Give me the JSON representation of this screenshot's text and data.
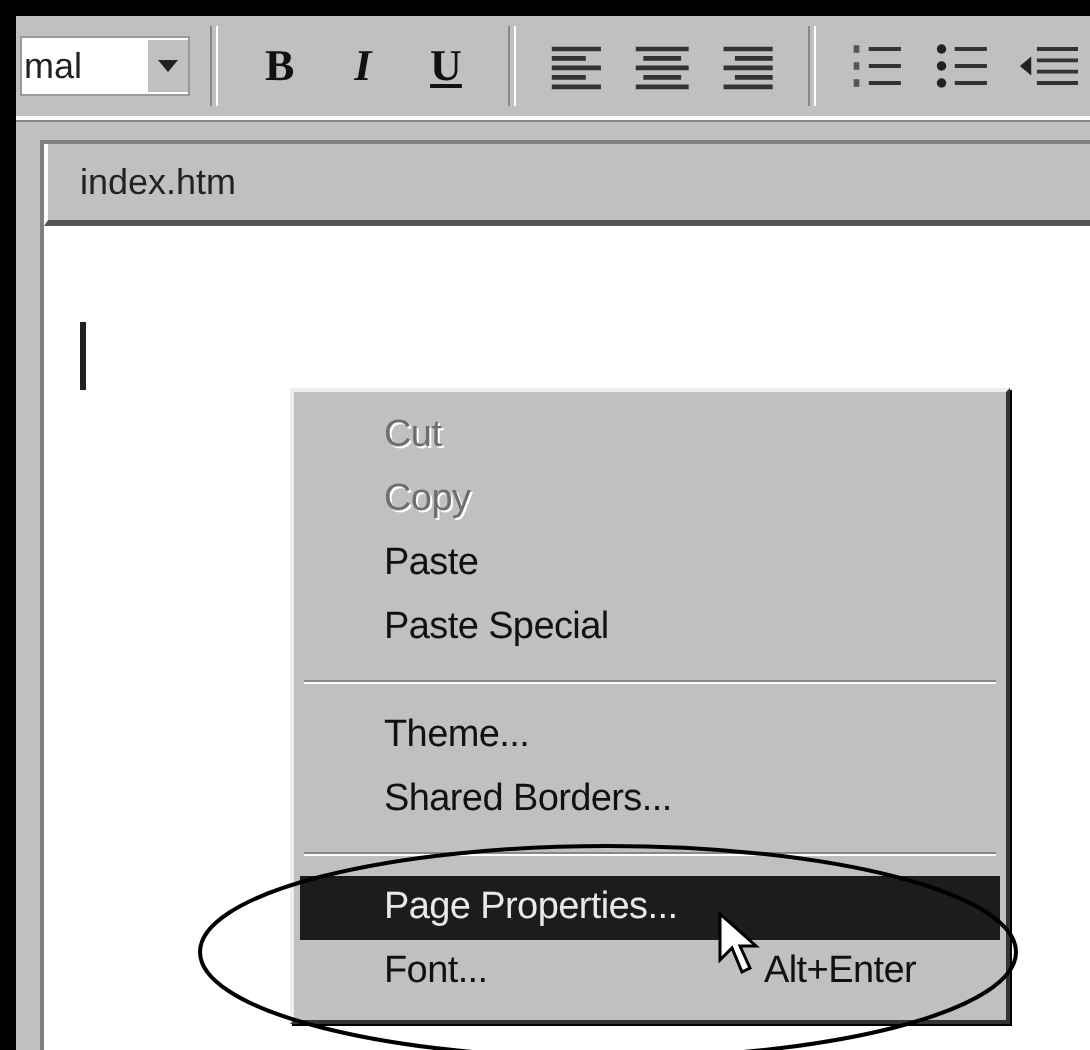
{
  "toolbar": {
    "style_field": {
      "value": "mal"
    },
    "format_buttons": [
      {
        "kind": "bold",
        "label": "B"
      },
      {
        "kind": "italic",
        "label": "I"
      },
      {
        "kind": "underline",
        "label": "U"
      }
    ]
  },
  "document": {
    "tab": "index.htm"
  },
  "context_menu": {
    "items": [
      {
        "kind": "item",
        "label": "Cut",
        "disabled": true,
        "selected": false
      },
      {
        "kind": "item",
        "label": "Copy",
        "disabled": true,
        "selected": false
      },
      {
        "kind": "item",
        "label": "Paste",
        "disabled": false,
        "selected": false
      },
      {
        "kind": "item",
        "label": "Paste Special",
        "disabled": false,
        "selected": false
      },
      {
        "kind": "separator"
      },
      {
        "kind": "item",
        "label": "Theme...",
        "disabled": false,
        "selected": false
      },
      {
        "kind": "item",
        "label": "Shared Borders...",
        "disabled": false,
        "selected": false
      },
      {
        "kind": "separator"
      },
      {
        "kind": "item",
        "label": "Page Properties...",
        "disabled": false,
        "selected": true
      },
      {
        "kind": "item",
        "label": "Font...",
        "shortcut": "Alt+Enter",
        "disabled": false,
        "selected": false
      }
    ]
  }
}
